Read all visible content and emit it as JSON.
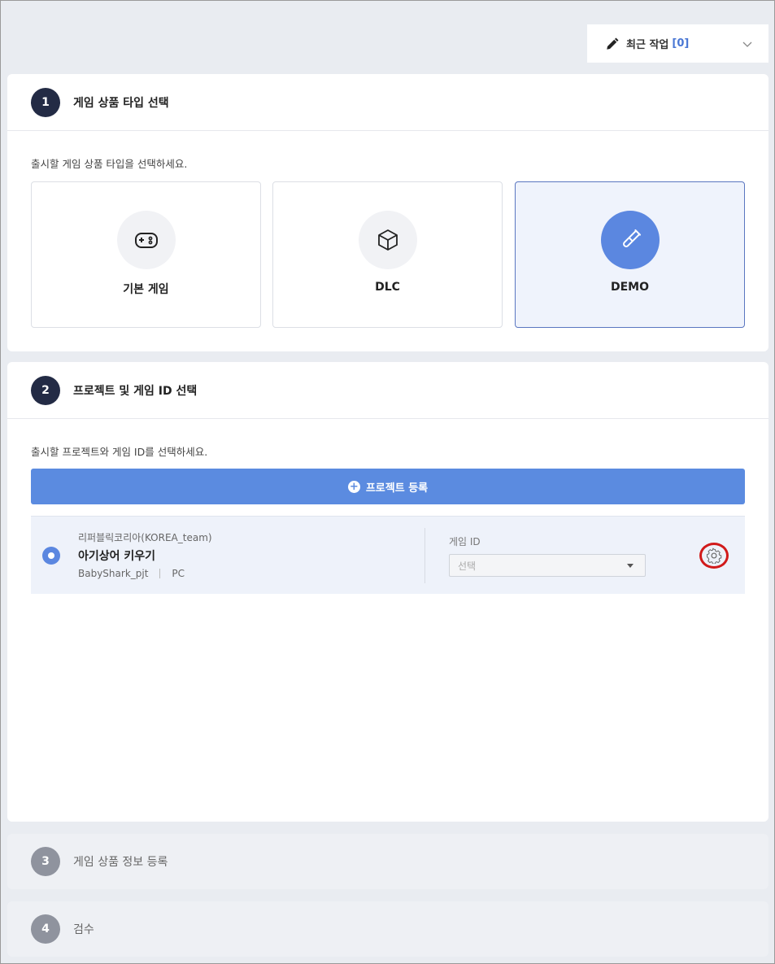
{
  "recent_work": {
    "label": "최근 작업",
    "count": "[0]"
  },
  "step1": {
    "number": "1",
    "title": "게임 상품 타입 선택",
    "description": "출시할 게임 상품 타입을 선택하세요.",
    "types": [
      {
        "label": "기본 게임",
        "icon": "gamepad-icon",
        "selected": false
      },
      {
        "label": "DLC",
        "icon": "box-icon",
        "selected": false
      },
      {
        "label": "DEMO",
        "icon": "test-tube-icon",
        "selected": true
      }
    ]
  },
  "step2": {
    "number": "2",
    "title": "프로젝트 및 게임 ID 선택",
    "description": "출시할 프로젝트와 게임 ID를 선택하세요.",
    "register_label": "프로젝트 등록",
    "project": {
      "team": "리퍼블릭코리아(KOREA_team)",
      "name": "아기상어 키우기",
      "code": "BabyShark_pjt",
      "platform": "PC",
      "game_id_label": "게임 ID",
      "game_id_placeholder": "선택"
    }
  },
  "step3": {
    "number": "3",
    "title": "게임 상품 정보 등록"
  },
  "step4": {
    "number": "4",
    "title": "검수"
  },
  "colors": {
    "accent": "#5b8be0",
    "step_dark": "#232b45",
    "highlight": "#d11a1a"
  }
}
